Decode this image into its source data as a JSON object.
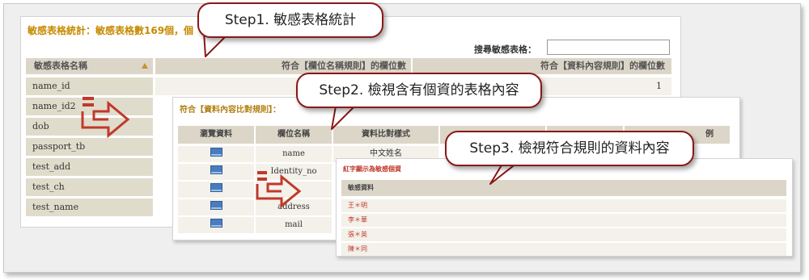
{
  "panel1": {
    "title": "敏感表格統計：敏感表格數169個，個",
    "search_label": "搜尋敏感表格：",
    "search_placeholder": "",
    "columns": [
      "敏感表格名稱",
      "符合【欄位名稱規則】的欄位數",
      "符合【資料內容規則】的欄位數"
    ],
    "rows": [
      {
        "name": "name_id",
        "col3": "1"
      },
      {
        "name": "name_id2",
        "col3": ""
      },
      {
        "name": "dob",
        "col3": ""
      },
      {
        "name": "passport_tb",
        "col3": ""
      },
      {
        "name": "test_add",
        "col3": ""
      },
      {
        "name": "test_ch",
        "col3": ""
      },
      {
        "name": "test_name",
        "col3": ""
      }
    ]
  },
  "panel2": {
    "title": "符合【資料內容比對規則】：",
    "columns": [
      "瀏覽資料",
      "欄位名稱",
      "資料比對樣式",
      "",
      "",
      "例"
    ],
    "rows": [
      {
        "field": "name",
        "pattern": "中文姓名"
      },
      {
        "field": "Identity_no",
        "pattern": ""
      },
      {
        "field": "",
        "pattern": ""
      },
      {
        "field": "address",
        "pattern": ""
      },
      {
        "field": "mail",
        "pattern": ""
      }
    ]
  },
  "panel3": {
    "note": "紅字顯示為敏感個資",
    "column": "敏感資料",
    "rows": [
      "王＊明",
      "李＊華",
      "張＊英",
      "陳＊同"
    ]
  },
  "callouts": {
    "step1": "Step1. 敏感表格統計",
    "step2": "Step2. 檢視含有個資的表格內容",
    "step3": "Step3. 檢視符合規則的資料內容"
  },
  "colors": {
    "title_gold": "#c68a00",
    "header_bg": "#dcd6c9",
    "callout_border": "#8b1818",
    "arrow_red": "#c0392b",
    "sensitive_red": "#c0392b"
  }
}
